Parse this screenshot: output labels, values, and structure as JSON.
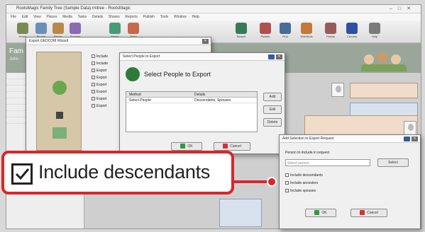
{
  "app": {
    "title": "RootsMagic Family Tree (Sample Data).rmtree - RootsMagic",
    "menus": [
      "File",
      "Edit",
      "View",
      "Places",
      "Media",
      "Tasks",
      "Details",
      "Shares",
      "Reports",
      "Publish",
      "Tools",
      "Window",
      "Help"
    ],
    "toolbar": [
      {
        "label": "Home",
        "icon": "home-icon",
        "color": "#7a8a52"
      },
      {
        "label": "People",
        "icon": "people-icon",
        "color": "#6a8fb8"
      },
      {
        "label": "Places",
        "icon": "places-icon",
        "color": "#b88a4a"
      },
      {
        "label": "Sources",
        "icon": "sources-icon",
        "color": "#8a6ab0"
      },
      {
        "label": "Media",
        "icon": "media-icon",
        "color": "#4a9a7a"
      },
      {
        "label": "Tasks",
        "icon": "tasks-icon",
        "color": "#c46a4a"
      },
      {
        "label": "Search",
        "icon": "search-icon",
        "color": "#3a7a5a"
      },
      {
        "label": "Publish",
        "icon": "publish-icon",
        "color": "#b05050"
      },
      {
        "label": "Find",
        "icon": "find-icon",
        "color": "#4a6a9a"
      },
      {
        "label": "WebHints",
        "icon": "webhints-icon",
        "color": "#c07a3a"
      },
      {
        "label": "Family",
        "icon": "family-icon",
        "color": "#9a5a5a"
      },
      {
        "label": "Country",
        "icon": "flag-icon",
        "color": "#3050a0"
      },
      {
        "label": "Help",
        "icon": "help-icon",
        "color": "#7a7a7a"
      }
    ],
    "banner_title": "Fam",
    "banner_subtitle": "John"
  },
  "export_dialog": {
    "title": "Export GEDCOM Wizard",
    "options": [
      "Include",
      "Include",
      "Export",
      "Export",
      "Export",
      "Export",
      "Export",
      "Export"
    ]
  },
  "select_dialog": {
    "title": "Select People to Export",
    "heading": "Select People to Export",
    "columns": [
      "Method",
      "Details"
    ],
    "rows": [
      [
        "Select People",
        "Descendants, Spouses"
      ]
    ],
    "buttons": {
      "add": "Add",
      "edit": "Edit",
      "delete": "Delete",
      "ok": "OK",
      "cancel": "Cancel"
    }
  },
  "selection_dialog": {
    "title": "Add Selection to Export Request",
    "prompt": "Person to include in request",
    "field": "Select person",
    "button": "Select",
    "checkboxes": [
      "Include descendants",
      "Include ancestors",
      "Include spouses"
    ],
    "buttons": {
      "ok": "OK",
      "cancel": "Cancel"
    }
  },
  "callout": {
    "text": "Include descendants",
    "checked": true,
    "accent": "#d9262b"
  }
}
